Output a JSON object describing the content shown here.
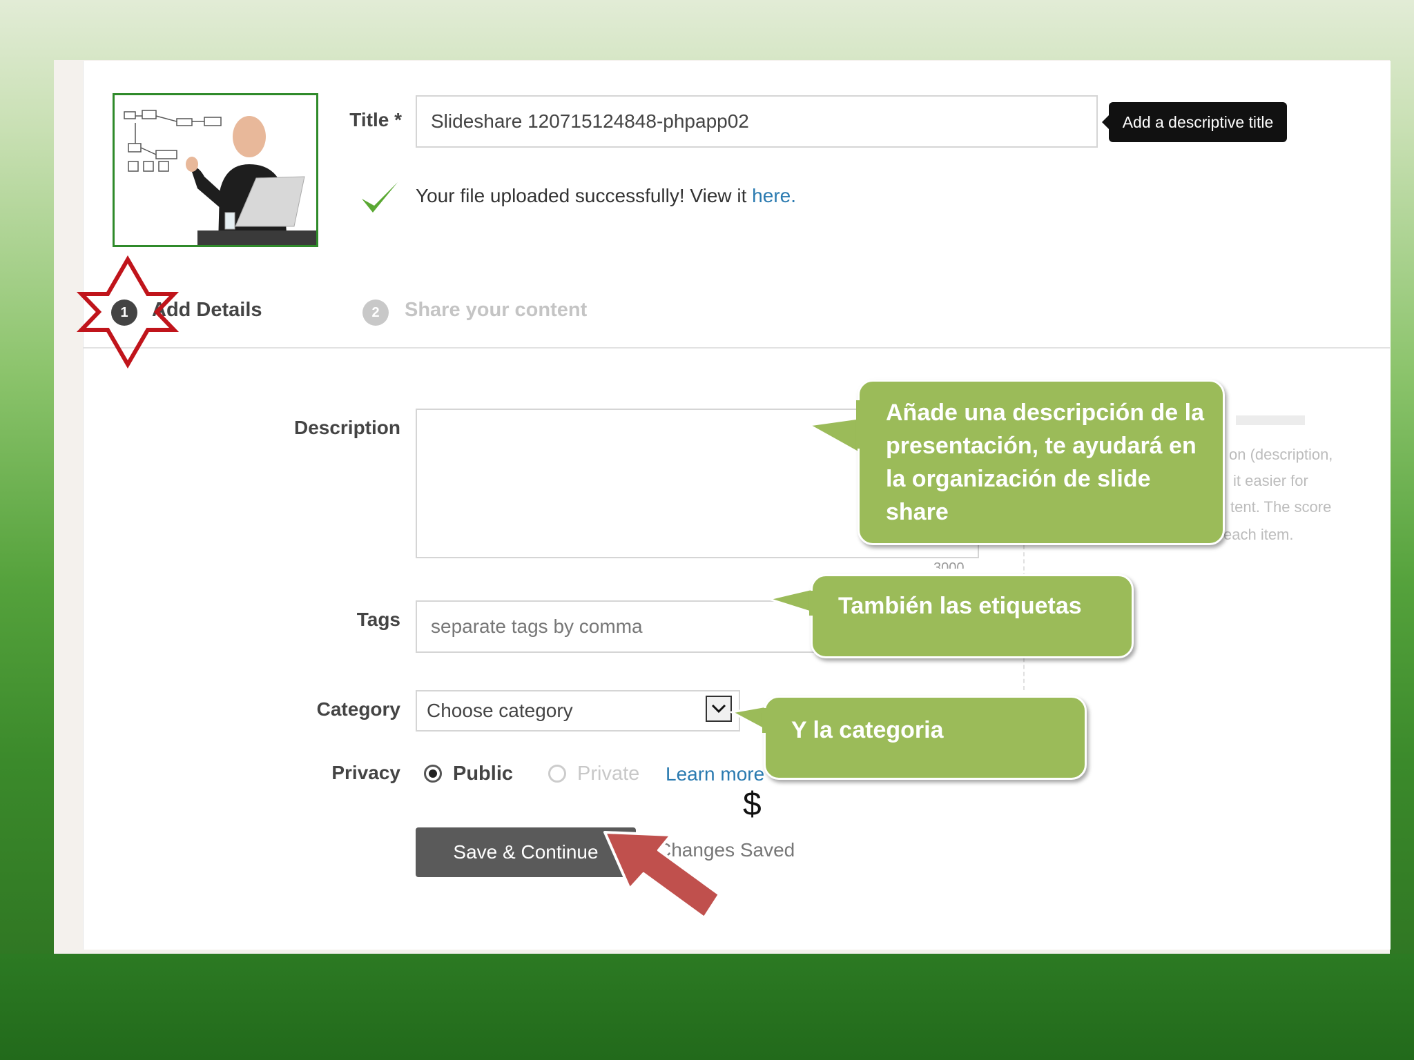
{
  "form": {
    "title_label": "Title *",
    "title_value": "Slideshare 120715124848-phpapp02",
    "title_tooltip": "Add a descriptive title",
    "upload_message": "Your file uploaded successfully! View it ",
    "upload_link": "here",
    "upload_period": ".",
    "description_label": "Description",
    "tags_label": "Tags",
    "tags_placeholder": "separate tags by comma",
    "category_label": "Category",
    "category_value": "Choose category",
    "privacy_label": "Privacy",
    "privacy_public": "Public",
    "privacy_private": "Private",
    "learn_more": "Learn more",
    "save_button": "Save & Continue",
    "changes_saved": "Changes Saved",
    "dollar": "$",
    "char_count_partial": "3000"
  },
  "steps": [
    {
      "number": "1",
      "label": "Add Details"
    },
    {
      "number": "2",
      "label": "Share your content"
    }
  ],
  "hidden_help": {
    "line1": "on (description,",
    "line2": "it easier for",
    "line3": "tent. The score",
    "line4": "each item."
  },
  "callouts": {
    "description": "Añade una descripción  de la presentación, te ayudará en la organización de slide share",
    "tags": "También las etiquetas",
    "category": "Y la categoria"
  },
  "colors": {
    "callout": "#9bbb59",
    "star": "#c0141b",
    "arrow": "#c0504d",
    "button": "#5a5a5a",
    "link": "#2a7ab0"
  },
  "icons": {
    "checkmark": "check-icon",
    "star": "star-icon",
    "arrow": "arrow-icon",
    "dropdown": "chevron-down-icon"
  }
}
